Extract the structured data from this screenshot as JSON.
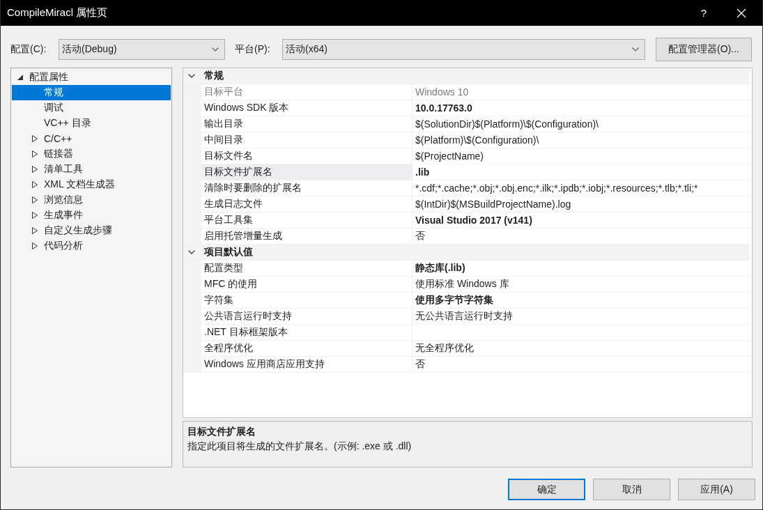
{
  "window": {
    "title": "CompileMiracl 属性页",
    "help": "?"
  },
  "toolbar": {
    "configuration": {
      "label": "配置(C):",
      "value": "活动(Debug)"
    },
    "platform": {
      "label": "平台(P):",
      "value": "活动(x64)"
    },
    "manager_button": "配置管理器(O)..."
  },
  "tree": [
    {
      "label": "配置属性",
      "kind": "group",
      "expanded": true,
      "selected": false,
      "children": [
        {
          "label": "常规",
          "kind": "leaf",
          "selected": true
        },
        {
          "label": "调试",
          "kind": "leaf",
          "selected": false
        },
        {
          "label": "VC++ 目录",
          "kind": "leaf",
          "selected": false
        },
        {
          "label": "C/C++",
          "kind": "group",
          "expanded": false,
          "selected": false
        },
        {
          "label": "链接器",
          "kind": "group",
          "expanded": false,
          "selected": false
        },
        {
          "label": "清单工具",
          "kind": "group",
          "expanded": false,
          "selected": false
        },
        {
          "label": "XML 文档生成器",
          "kind": "group",
          "expanded": false,
          "selected": false
        },
        {
          "label": "浏览信息",
          "kind": "group",
          "expanded": false,
          "selected": false
        },
        {
          "label": "生成事件",
          "kind": "group",
          "expanded": false,
          "selected": false
        },
        {
          "label": "自定义生成步骤",
          "kind": "group",
          "expanded": false,
          "selected": false
        },
        {
          "label": "代码分析",
          "kind": "group",
          "expanded": false,
          "selected": false
        }
      ]
    }
  ],
  "property_grid": {
    "categories": [
      {
        "name": "常规",
        "expanded": true,
        "properties": [
          {
            "name": "目标平台",
            "value": "Windows 10",
            "disabled": true,
            "modified": false,
            "selected": false
          },
          {
            "name": "Windows SDK 版本",
            "value": "10.0.17763.0",
            "disabled": false,
            "modified": true,
            "selected": false
          },
          {
            "name": "输出目录",
            "value": "$(SolutionDir)$(Platform)\\$(Configuration)\\",
            "disabled": false,
            "modified": false,
            "selected": false
          },
          {
            "name": "中间目录",
            "value": "$(Platform)\\$(Configuration)\\",
            "disabled": false,
            "modified": false,
            "selected": false
          },
          {
            "name": "目标文件名",
            "value": "$(ProjectName)",
            "disabled": false,
            "modified": false,
            "selected": false
          },
          {
            "name": "目标文件扩展名",
            "value": ".lib",
            "disabled": false,
            "modified": true,
            "selected": true
          },
          {
            "name": "清除时要删除的扩展名",
            "value": "*.cdf;*.cache;*.obj;*.obj.enc;*.ilk;*.ipdb;*.iobj;*.resources;*.tlb;*.tli;*",
            "disabled": false,
            "modified": false,
            "selected": false
          },
          {
            "name": "生成日志文件",
            "value": "$(IntDir)$(MSBuildProjectName).log",
            "disabled": false,
            "modified": false,
            "selected": false
          },
          {
            "name": "平台工具集",
            "value": "Visual Studio 2017 (v141)",
            "disabled": false,
            "modified": true,
            "selected": false
          },
          {
            "name": "启用托管增量生成",
            "value": "否",
            "disabled": false,
            "modified": false,
            "selected": false
          }
        ]
      },
      {
        "name": "项目默认值",
        "expanded": true,
        "properties": [
          {
            "name": "配置类型",
            "value": "静态库(.lib)",
            "disabled": false,
            "modified": true,
            "selected": false
          },
          {
            "name": "MFC 的使用",
            "value": "使用标准 Windows 库",
            "disabled": false,
            "modified": false,
            "selected": false
          },
          {
            "name": "字符集",
            "value": "使用多字节字符集",
            "disabled": false,
            "modified": true,
            "selected": false
          },
          {
            "name": "公共语言运行时支持",
            "value": "无公共语言运行时支持",
            "disabled": false,
            "modified": false,
            "selected": false
          },
          {
            "name": ".NET 目标框架版本",
            "disabled": false,
            "selected": false
          },
          {
            "name": "全程序优化",
            "value": "无全程序优化",
            "disabled": false,
            "modified": false,
            "selected": false
          },
          {
            "name": "Windows 应用商店应用支持",
            "value": "否",
            "disabled": false,
            "modified": false,
            "selected": false
          }
        ]
      }
    ]
  },
  "description": {
    "title": "目标文件扩展名",
    "text": "指定此项目将生成的文件扩展名。(示例: .exe 或 .dll)"
  },
  "buttons": [
    {
      "label": "确定",
      "default": true
    },
    {
      "label": "取消",
      "default": false
    },
    {
      "label": "应用(A)",
      "default": false
    }
  ]
}
